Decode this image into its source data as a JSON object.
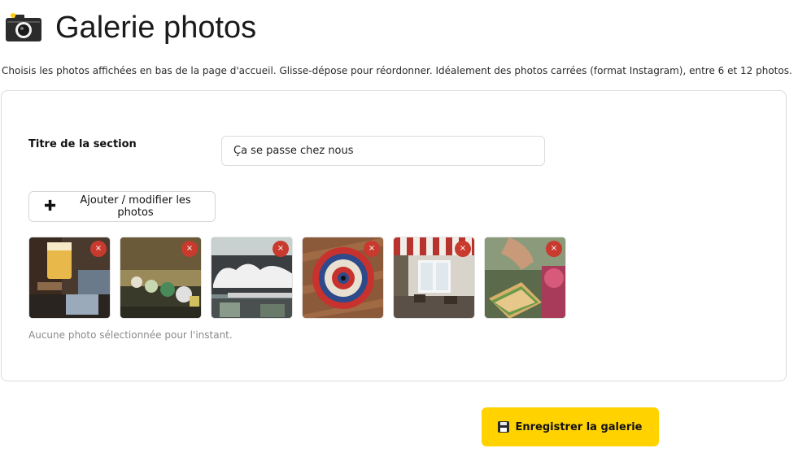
{
  "header": {
    "title": "Galerie photos",
    "icon": "camera-icon"
  },
  "subtitle": "Choisis les photos affichées en bas de la page d'accueil. Glisse-dépose pour réordonner. Idéalement des photos carrées (format Instagram), entre 6 et 12 photos.",
  "form": {
    "section_title_label": "Titre de la section",
    "section_title_value": "Ça se passe chez nous"
  },
  "add_button_label": "Ajouter / modifier les photos",
  "photos": [
    {
      "name": "beer-photo",
      "remove_icon": "×"
    },
    {
      "name": "taps-photo",
      "remove_icon": "×"
    },
    {
      "name": "market-sign-photo",
      "remove_icon": "×"
    },
    {
      "name": "dartboard-photo",
      "remove_icon": "×"
    },
    {
      "name": "terrace-photo",
      "remove_icon": "×"
    },
    {
      "name": "sandwich-photo",
      "remove_icon": "×"
    }
  ],
  "empty_note": "Aucune photo sélectionnée pour l'instant.",
  "save_button_label": "Enregistrer la galerie",
  "colors": {
    "accent": "#ffd200",
    "remove": "#c93a2e"
  }
}
